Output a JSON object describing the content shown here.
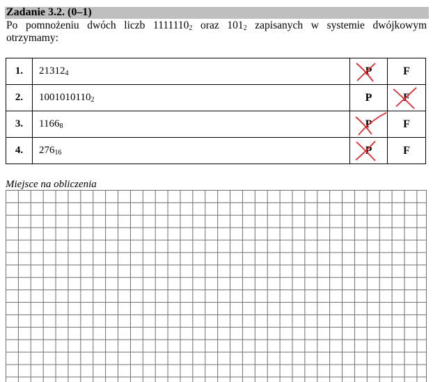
{
  "task": {
    "title": "Zadanie 3.2. (0–1)",
    "prompt_parts": {
      "a": "Po pomnożeniu dwóch liczb 1111110",
      "a_sub": "2",
      "b": " oraz 101",
      "b_sub": "2",
      "c": " zapisanych w systemie dwójkowym otrzymamy:"
    }
  },
  "options": [
    {
      "num": "1.",
      "value": "21312",
      "base": "4",
      "p": "P",
      "f": "F"
    },
    {
      "num": "2.",
      "value": "1001010110",
      "base": "2",
      "p": "P",
      "f": "F"
    },
    {
      "num": "3.",
      "value": "1166",
      "base": "8",
      "p": "P",
      "f": "F"
    },
    {
      "num": "4.",
      "value": "276",
      "base": "16",
      "p": "P",
      "f": "F"
    }
  ],
  "calc": {
    "label": "Miejsce na obliczenia"
  },
  "colors": {
    "title_bar": "#bfbfbf",
    "mark": "#e0282c",
    "grid": "#6e6e6e"
  }
}
